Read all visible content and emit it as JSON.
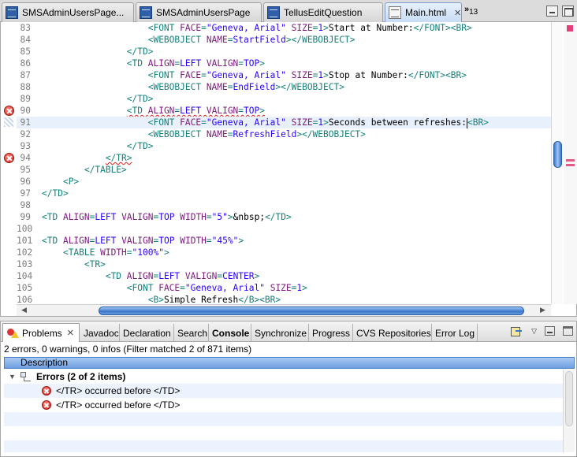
{
  "editor_tabs": [
    {
      "label": "SMSAdminUsersPage...",
      "icon": "webobject-file-icon"
    },
    {
      "label": "SMSAdminUsersPage",
      "icon": "webobject-file-icon"
    },
    {
      "label": "TellusEditQuestion",
      "icon": "webobject-file-icon"
    },
    {
      "label": "Main.html",
      "icon": "html-file-icon",
      "active": true,
      "close": "✕"
    }
  ],
  "more_tabs": {
    "chevron": "»",
    "count": "13"
  },
  "code_lines": [
    {
      "n": "83",
      "tokens": [
        {
          "t": "                    "
        },
        {
          "c": "tag",
          "t": "<FONT "
        },
        {
          "c": "attr",
          "t": "FACE"
        },
        {
          "c": "tag",
          "t": "="
        },
        {
          "c": "val",
          "t": "\"Geneva, Arial\""
        },
        {
          "c": "tag",
          "t": " "
        },
        {
          "c": "attr",
          "t": "SIZE"
        },
        {
          "c": "tag",
          "t": "="
        },
        {
          "c": "val",
          "t": "1"
        },
        {
          "c": "tag",
          "t": ">"
        },
        {
          "c": "txt",
          "t": "Start at Number:"
        },
        {
          "c": "tag",
          "t": "</FONT><BR>"
        }
      ]
    },
    {
      "n": "84",
      "tokens": [
        {
          "t": "                    "
        },
        {
          "c": "tag",
          "t": "<WEBOBJECT "
        },
        {
          "c": "attr",
          "t": "NAME"
        },
        {
          "c": "tag",
          "t": "="
        },
        {
          "c": "val",
          "t": "StartField"
        },
        {
          "c": "tag",
          "t": "></WEBOBJECT>"
        }
      ]
    },
    {
      "n": "85",
      "tokens": [
        {
          "t": "                "
        },
        {
          "c": "tag",
          "t": "</TD>"
        }
      ]
    },
    {
      "n": "86",
      "tokens": [
        {
          "t": "                "
        },
        {
          "c": "tag",
          "t": "<TD "
        },
        {
          "c": "attr",
          "t": "ALIGN"
        },
        {
          "c": "tag",
          "t": "="
        },
        {
          "c": "val",
          "t": "LEFT"
        },
        {
          "c": "tag",
          "t": " "
        },
        {
          "c": "attr",
          "t": "VALIGN"
        },
        {
          "c": "tag",
          "t": "="
        },
        {
          "c": "val",
          "t": "TOP"
        },
        {
          "c": "tag",
          "t": ">"
        }
      ]
    },
    {
      "n": "87",
      "tokens": [
        {
          "t": "                    "
        },
        {
          "c": "tag",
          "t": "<FONT "
        },
        {
          "c": "attr",
          "t": "FACE"
        },
        {
          "c": "tag",
          "t": "="
        },
        {
          "c": "val",
          "t": "\"Geneva, Arial\""
        },
        {
          "c": "tag",
          "t": " "
        },
        {
          "c": "attr",
          "t": "SIZE"
        },
        {
          "c": "tag",
          "t": "="
        },
        {
          "c": "val",
          "t": "1"
        },
        {
          "c": "tag",
          "t": ">"
        },
        {
          "c": "txt",
          "t": "Stop at Number:"
        },
        {
          "c": "tag",
          "t": "</FONT><BR>"
        }
      ]
    },
    {
      "n": "88",
      "tokens": [
        {
          "t": "                    "
        },
        {
          "c": "tag",
          "t": "<WEBOBJECT "
        },
        {
          "c": "attr",
          "t": "NAME"
        },
        {
          "c": "tag",
          "t": "="
        },
        {
          "c": "val",
          "t": "EndField"
        },
        {
          "c": "tag",
          "t": "></WEBOBJECT>"
        }
      ]
    },
    {
      "n": "89",
      "tokens": [
        {
          "t": "                "
        },
        {
          "c": "tag",
          "t": "</TD>"
        }
      ]
    },
    {
      "n": "90",
      "error": true,
      "tokens": [
        {
          "t": "                "
        },
        {
          "c": "tag squig",
          "t": "<TD "
        },
        {
          "c": "attr squig",
          "t": "ALIGN"
        },
        {
          "c": "tag squig",
          "t": "="
        },
        {
          "c": "val squig",
          "t": "LEFT"
        },
        {
          "c": "tag squig",
          "t": " "
        },
        {
          "c": "attr squig",
          "t": "VALIGN"
        },
        {
          "c": "tag squig",
          "t": "="
        },
        {
          "c": "val squig",
          "t": "TOP"
        },
        {
          "c": "tag squig",
          "t": ">"
        }
      ]
    },
    {
      "n": "91",
      "current": true,
      "tokens": [
        {
          "t": "                    "
        },
        {
          "c": "tag",
          "t": "<FONT "
        },
        {
          "c": "attr",
          "t": "FACE"
        },
        {
          "c": "tag",
          "t": "="
        },
        {
          "c": "val",
          "t": "\"Geneva, Arial\""
        },
        {
          "c": "tag",
          "t": " "
        },
        {
          "c": "attr",
          "t": "SIZE"
        },
        {
          "c": "tag",
          "t": "="
        },
        {
          "c": "val",
          "t": "1"
        },
        {
          "c": "tag",
          "t": ">"
        },
        {
          "c": "txt",
          "t": "Seconds between refreshes:"
        },
        {
          "c": "caret",
          "t": ""
        },
        {
          "c": "tag",
          "t": "<BR>"
        }
      ]
    },
    {
      "n": "92",
      "tokens": [
        {
          "t": "                    "
        },
        {
          "c": "tag",
          "t": "<WEBOBJECT "
        },
        {
          "c": "attr",
          "t": "NAME"
        },
        {
          "c": "tag",
          "t": "="
        },
        {
          "c": "val",
          "t": "RefreshField"
        },
        {
          "c": "tag",
          "t": "></WEBOBJECT>"
        }
      ]
    },
    {
      "n": "93",
      "tokens": [
        {
          "t": "                "
        },
        {
          "c": "tag",
          "t": "</TD>"
        }
      ]
    },
    {
      "n": "94",
      "error": true,
      "tokens": [
        {
          "t": "            "
        },
        {
          "c": "tag squig",
          "t": "</TR>"
        }
      ]
    },
    {
      "n": "95",
      "tokens": [
        {
          "t": "        "
        },
        {
          "c": "tag",
          "t": "</TABLE>"
        }
      ]
    },
    {
      "n": "96",
      "tokens": [
        {
          "t": "    "
        },
        {
          "c": "tag",
          "t": "<P>"
        }
      ]
    },
    {
      "n": "97",
      "tokens": [
        {
          "c": "tag",
          "t": "</TD>"
        }
      ]
    },
    {
      "n": "98",
      "tokens": []
    },
    {
      "n": "99",
      "tokens": [
        {
          "c": "tag",
          "t": "<TD "
        },
        {
          "c": "attr",
          "t": "ALIGN"
        },
        {
          "c": "tag",
          "t": "="
        },
        {
          "c": "val",
          "t": "LEFT"
        },
        {
          "c": "tag",
          "t": " "
        },
        {
          "c": "attr",
          "t": "VALIGN"
        },
        {
          "c": "tag",
          "t": "="
        },
        {
          "c": "val",
          "t": "TOP"
        },
        {
          "c": "tag",
          "t": " "
        },
        {
          "c": "attr",
          "t": "WIDTH"
        },
        {
          "c": "tag",
          "t": "="
        },
        {
          "c": "val",
          "t": "\"5\""
        },
        {
          "c": "tag",
          "t": ">"
        },
        {
          "c": "txt",
          "t": "&nbsp;"
        },
        {
          "c": "tag",
          "t": "</TD>"
        }
      ]
    },
    {
      "n": "100",
      "tokens": []
    },
    {
      "n": "101",
      "tokens": [
        {
          "c": "tag",
          "t": "<TD "
        },
        {
          "c": "attr",
          "t": "ALIGN"
        },
        {
          "c": "tag",
          "t": "="
        },
        {
          "c": "val",
          "t": "LEFT"
        },
        {
          "c": "tag",
          "t": " "
        },
        {
          "c": "attr",
          "t": "VALIGN"
        },
        {
          "c": "tag",
          "t": "="
        },
        {
          "c": "val",
          "t": "TOP"
        },
        {
          "c": "tag",
          "t": " "
        },
        {
          "c": "attr",
          "t": "WIDTH"
        },
        {
          "c": "tag",
          "t": "="
        },
        {
          "c": "val",
          "t": "\"45%\""
        },
        {
          "c": "tag",
          "t": ">"
        }
      ]
    },
    {
      "n": "102",
      "tokens": [
        {
          "t": "    "
        },
        {
          "c": "tag",
          "t": "<TABLE "
        },
        {
          "c": "attr",
          "t": "WIDTH"
        },
        {
          "c": "tag",
          "t": "="
        },
        {
          "c": "val",
          "t": "\"100%\""
        },
        {
          "c": "tag",
          "t": ">"
        }
      ]
    },
    {
      "n": "103",
      "tokens": [
        {
          "t": "        "
        },
        {
          "c": "tag",
          "t": "<TR>"
        }
      ]
    },
    {
      "n": "104",
      "tokens": [
        {
          "t": "            "
        },
        {
          "c": "tag",
          "t": "<TD "
        },
        {
          "c": "attr",
          "t": "ALIGN"
        },
        {
          "c": "tag",
          "t": "="
        },
        {
          "c": "val",
          "t": "LEFT"
        },
        {
          "c": "tag",
          "t": " "
        },
        {
          "c": "attr",
          "t": "VALIGN"
        },
        {
          "c": "tag",
          "t": "="
        },
        {
          "c": "val",
          "t": "CENTER"
        },
        {
          "c": "tag",
          "t": ">"
        }
      ]
    },
    {
      "n": "105",
      "tokens": [
        {
          "t": "                "
        },
        {
          "c": "tag",
          "t": "<FONT "
        },
        {
          "c": "attr",
          "t": "FACE"
        },
        {
          "c": "tag",
          "t": "="
        },
        {
          "c": "val",
          "t": "\"Geneva, Arial\""
        },
        {
          "c": "tag",
          "t": " "
        },
        {
          "c": "attr",
          "t": "SIZE"
        },
        {
          "c": "tag",
          "t": "="
        },
        {
          "c": "val",
          "t": "1"
        },
        {
          "c": "tag",
          "t": ">"
        }
      ]
    },
    {
      "n": "106",
      "tokens": [
        {
          "t": "                    "
        },
        {
          "c": "tag",
          "t": "<B>"
        },
        {
          "c": "txt",
          "t": "Simple Refresh"
        },
        {
          "c": "tag",
          "t": "</B><BR>"
        }
      ]
    }
  ],
  "view_tabs": [
    {
      "label": "Problems",
      "active": true,
      "close": "✕"
    },
    {
      "label": "Javadoc"
    },
    {
      "label": "Declaration"
    },
    {
      "label": "Search"
    },
    {
      "label": "Console",
      "bold": true
    },
    {
      "label": "Synchronize"
    },
    {
      "label": "Progress"
    },
    {
      "label": "CVS Repositories"
    },
    {
      "label": "Error Log"
    }
  ],
  "problems": {
    "summary": "2 errors, 0 warnings, 0 infos (Filter matched 2 of 871 items)",
    "column": "Description",
    "group": {
      "label": "Errors (2 of 2 items)",
      "expanded_glyph": "▼"
    },
    "items": [
      {
        "label": "</TR> occurred before </TD>",
        "icon": "error-icon"
      },
      {
        "label": "</TR> occurred before </TD>",
        "icon": "error-icon"
      }
    ]
  },
  "colors": {
    "tag": "#14807a",
    "attr": "#7d197d",
    "value": "#2a00ff",
    "error": "#d0211a",
    "selection": "#6f9fe0"
  }
}
